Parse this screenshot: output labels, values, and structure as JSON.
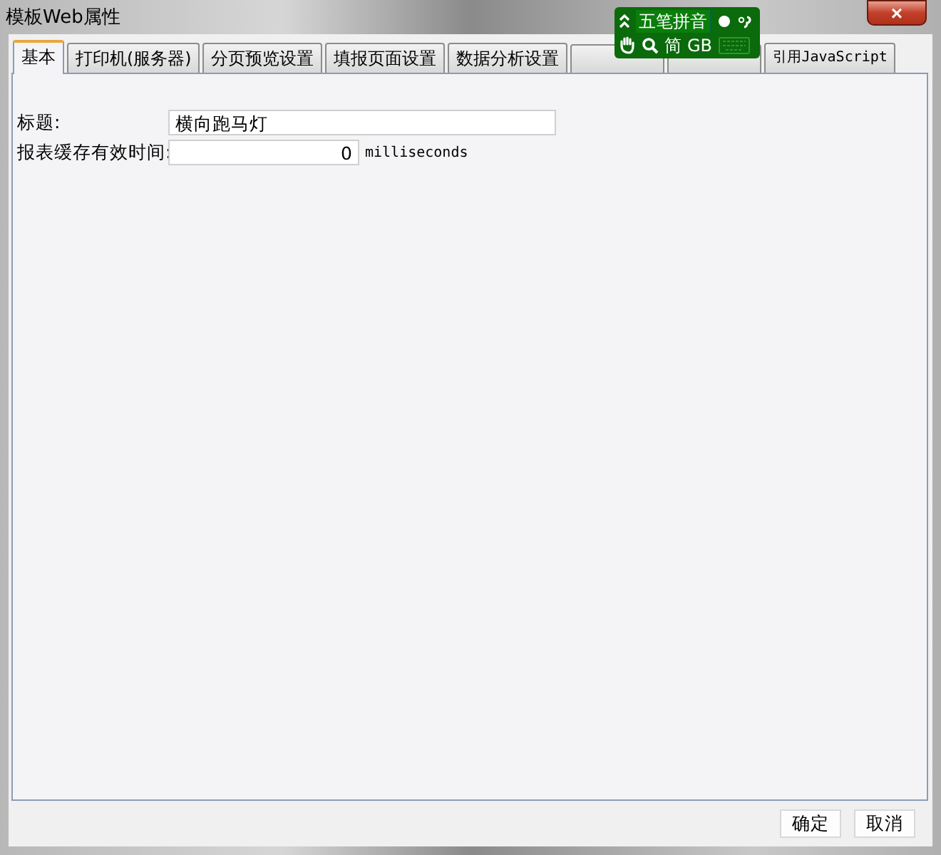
{
  "window": {
    "title": "模板Web属性",
    "close": "×"
  },
  "tabs": [
    {
      "label": "基本",
      "selected": true
    },
    {
      "label": "打印机(服务器)",
      "selected": false
    },
    {
      "label": "分页预览设置",
      "selected": false
    },
    {
      "label": "填报页面设置",
      "selected": false
    },
    {
      "label": "数据分析设置",
      "selected": false
    },
    {
      "selected": false
    },
    {
      "selected": false
    },
    {
      "label": "引用JavaScript",
      "selected": false
    }
  ],
  "fields": [
    {
      "label": "标题:",
      "value": "横向跑马灯"
    },
    {
      "label": "报表缓存有效时间:",
      "value": "0",
      "unit": "milliseconds"
    }
  ],
  "buttons": [
    "确定",
    "取消"
  ],
  "ime": {
    "mode": "五笔拼音",
    "script": "简",
    "charset": "GB"
  }
}
